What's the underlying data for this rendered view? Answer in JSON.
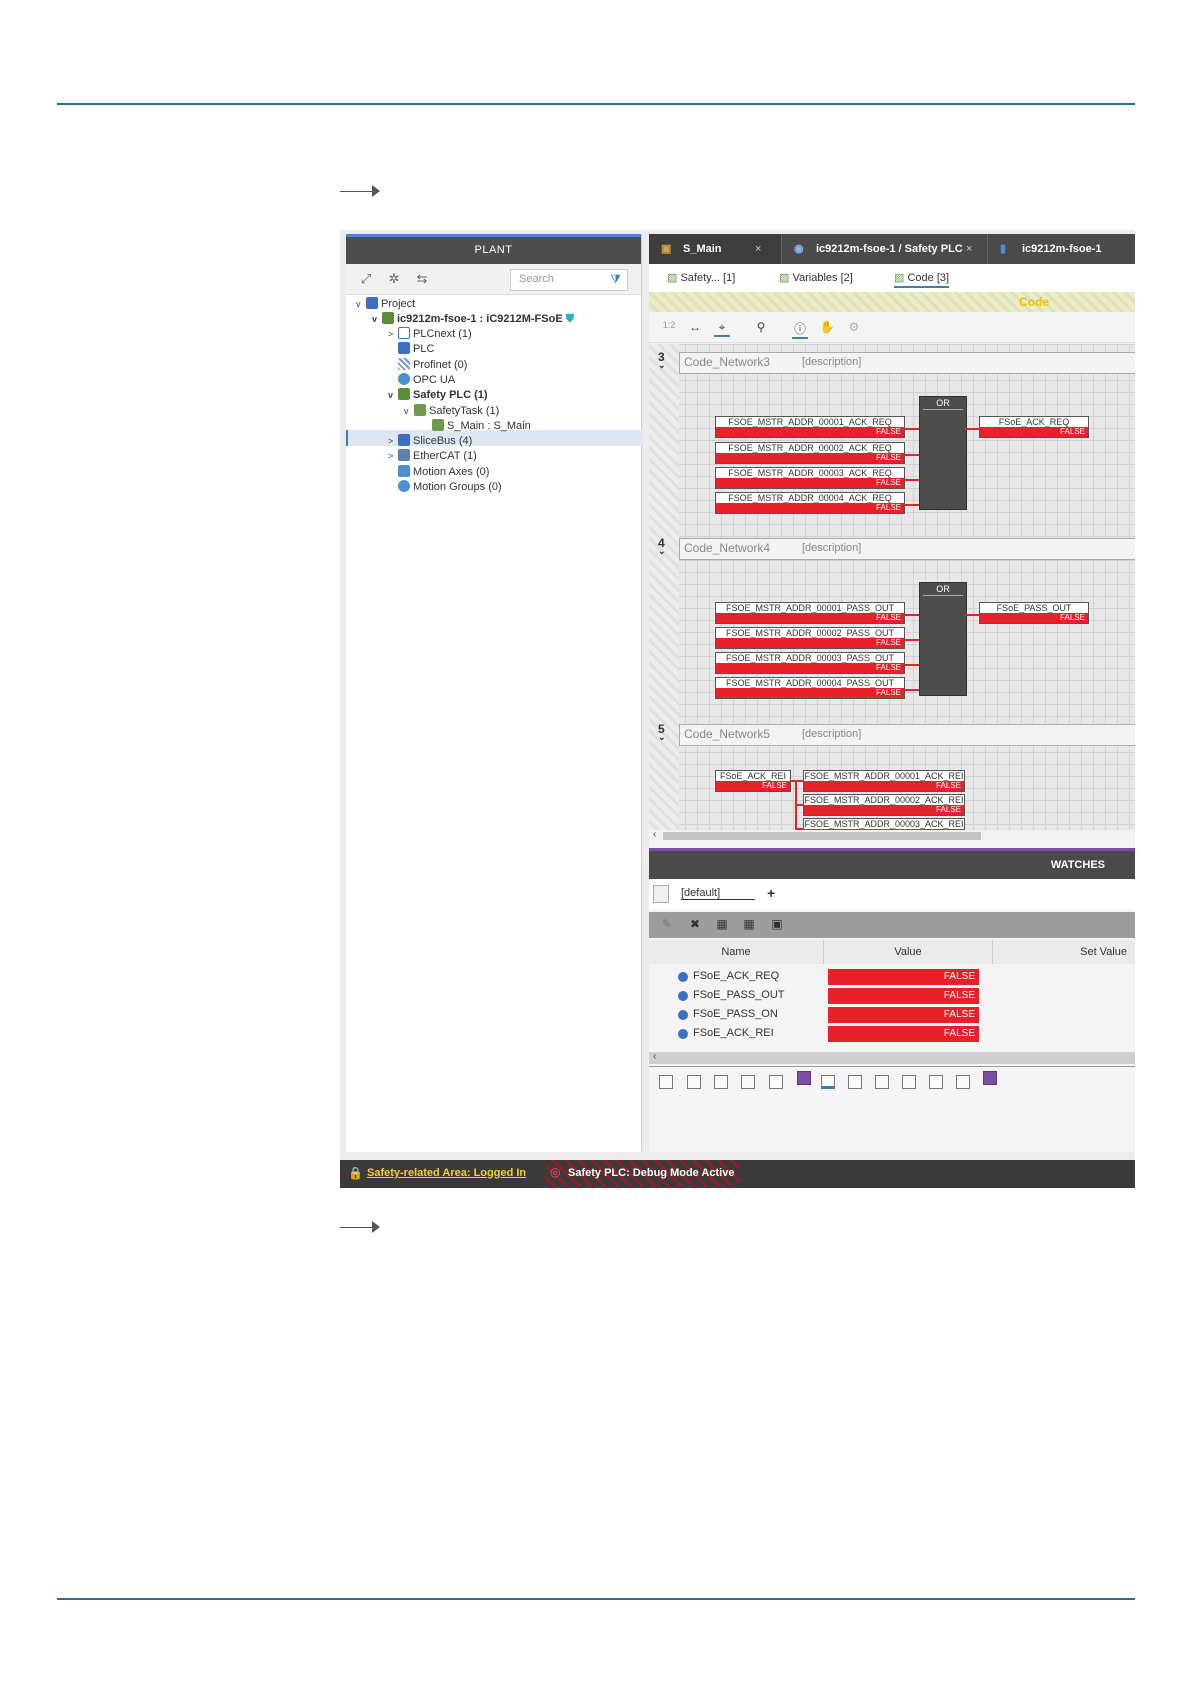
{
  "plant": {
    "title": "PLANT",
    "search_placeholder": "Search",
    "tree": [
      {
        "label": "Project",
        "caret": "v",
        "bold": false
      },
      {
        "label": "ic9212m-fsoe-1 : iC9212M-FSoE",
        "caret": "v",
        "bold": true
      },
      {
        "label": "PLCnext (1)",
        "caret": ">",
        "bold": false
      },
      {
        "label": "PLC",
        "caret": "",
        "bold": false
      },
      {
        "label": "Profinet (0)",
        "caret": "",
        "bold": false
      },
      {
        "label": "OPC UA",
        "caret": "",
        "bold": false
      },
      {
        "label": "Safety PLC (1)",
        "caret": "v",
        "bold": true
      },
      {
        "label": "SafetyTask (1)",
        "caret": "v",
        "bold": false
      },
      {
        "label": "S_Main : S_Main",
        "caret": "",
        "bold": false
      },
      {
        "label": "SliceBus (4)",
        "caret": ">",
        "bold": false
      },
      {
        "label": "EtherCAT (1)",
        "caret": ">",
        "bold": false
      },
      {
        "label": "Motion Axes (0)",
        "caret": "",
        "bold": false
      },
      {
        "label": "Motion Groups (0)",
        "caret": "",
        "bold": false
      }
    ]
  },
  "tabs": [
    {
      "label": "S_Main",
      "close": "×"
    },
    {
      "label": "ic9212m-fsoe-1 / Safety PLC",
      "close": "×"
    },
    {
      "label": "ic9212m-fsoe-1",
      "close": ""
    }
  ],
  "subtabs": [
    {
      "label": "Safety... [1]"
    },
    {
      "label": "Variables [2]"
    },
    {
      "label": "Code [3]"
    }
  ],
  "code_banner": "Code",
  "zoom_label": "1:2",
  "networks": [
    {
      "number": "3",
      "name": "Code_Network3",
      "desc": "[description]",
      "inputs": [
        "FSOE_MSTR_ADDR_00001_ACK_REQ",
        "FSOE_MSTR_ADDR_00002_ACK_REQ",
        "FSOE_MSTR_ADDR_00003_ACK_REQ",
        "FSOE_MSTR_ADDR_00004_ACK_REQ"
      ],
      "block": "OR",
      "output": "FSoE_ACK_REQ",
      "value": "FALSE"
    },
    {
      "number": "4",
      "name": "Code_Network4",
      "desc": "[description]",
      "inputs": [
        "FSOE_MSTR_ADDR_00001_PASS_OUT",
        "FSOE_MSTR_ADDR_00002_PASS_OUT",
        "FSOE_MSTR_ADDR_00003_PASS_OUT",
        "FSOE_MSTR_ADDR_00004_PASS_OUT"
      ],
      "block": "OR",
      "output": "FSoE_PASS_OUT",
      "value": "FALSE"
    },
    {
      "number": "5",
      "name": "Code_Network5",
      "desc": "[description]",
      "source": "FSoE_ACK_REI",
      "targets": [
        "FSOE_MSTR_ADDR_00001_ACK_REI",
        "FSOE_MSTR_ADDR_00002_ACK_REI",
        "FSOE_MSTR_ADDR_00003_ACK_REI"
      ],
      "value": "FALSE"
    }
  ],
  "watches": {
    "title": "WATCHES",
    "tab": "[default]",
    "add": "+",
    "columns": [
      "Name",
      "Value",
      "Set Value"
    ],
    "rows": [
      {
        "name": "FSoE_ACK_REQ",
        "value": "FALSE"
      },
      {
        "name": "FSoE_PASS_OUT",
        "value": "FALSE"
      },
      {
        "name": "FSoE_PASS_ON",
        "value": "FALSE"
      },
      {
        "name": "FSoE_ACK_REI",
        "value": "FALSE"
      }
    ]
  },
  "status": {
    "safety_area": "Safety-related Area: Logged In",
    "debug_mode": "Safety PLC: Debug Mode Active"
  },
  "colors": {
    "false_value": "#e8202a",
    "header": "#4a4a4a",
    "accent": "#3a7dbf",
    "warning": "#f3d22a",
    "watch_accent": "#7b4fa6"
  }
}
